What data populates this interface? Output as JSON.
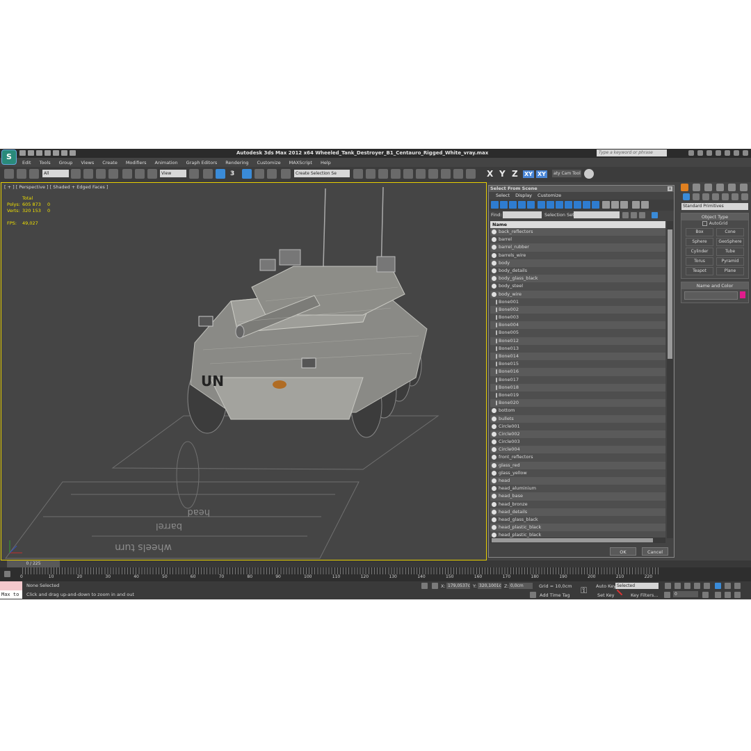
{
  "app": {
    "logo_letter": "S",
    "title": "Autodesk 3ds Max  2012 x64      Wheeled_Tank_Destroyer_B1_Centauro_Rigged_White_vray.max",
    "search_placeholder": "Type a keyword or phrase"
  },
  "menu": [
    "Edit",
    "Tools",
    "Group",
    "Views",
    "Create",
    "Modifiers",
    "Animation",
    "Graph Editors",
    "Rendering",
    "Customize",
    "MAXScript",
    "Help"
  ],
  "toolbar": {
    "filter": "All",
    "ref_coord": "View",
    "snap_label": "3",
    "selection_set": "Create Selection Se",
    "axes": [
      "X",
      "Y",
      "Z",
      "XY",
      "XY"
    ],
    "cam_tool": "aty Cam Tool"
  },
  "viewport": {
    "label": "[ + ] [ Perspective ] [ Shaded + Edged Faces ]",
    "stats": {
      "total_label": "Total",
      "polys_label": "Polys:",
      "polys_total": "605 873",
      "polys_sel": "0",
      "verts_label": "Verts:",
      "verts_total": "320 153",
      "verts_sel": "0",
      "fps_label": "FPS:",
      "fps_value": "49,027"
    },
    "hull_text": "UN",
    "ground_labels": [
      "head",
      "barrel",
      "wheels turn"
    ]
  },
  "dialog": {
    "title": "Select From Scene",
    "close_glyph": "x",
    "menu": [
      "Select",
      "Display",
      "Customize"
    ],
    "find_label": "Find:",
    "selection_set_label": "Selection Set:",
    "column_header": "Name",
    "items": [
      "back_reflectors",
      "barrel",
      "barrel_rubber",
      "barrels_wire",
      "body",
      "body_details",
      "body_glass_black",
      "body_steel",
      "body_wire",
      "Bone001",
      "Bone002",
      "Bone003",
      "Bone004",
      "Bone005",
      "Bone012",
      "Bone013",
      "Bone014",
      "Bone015",
      "Bone016",
      "Bone017",
      "Bone018",
      "Bone019",
      "Bone020",
      "bottom",
      "bullets",
      "Circle001",
      "Circle002",
      "Circle003",
      "Circle004",
      "front_reflectors",
      "glass_red",
      "glass_yellow",
      "head",
      "head_aluminium",
      "head_base",
      "head_bronze",
      "head_details",
      "head_glass_black",
      "head_plastic_black",
      "head_plastic_black"
    ],
    "ok_label": "OK",
    "cancel_label": "Cancel"
  },
  "command_panel": {
    "category": "Standard Primitives",
    "object_type_title": "Object Type",
    "autogrid_label": "AutoGrid",
    "buttons": [
      "Box",
      "Cone",
      "Sphere",
      "GeoSphere",
      "Cylinder",
      "Tube",
      "Torus",
      "Pyramid",
      "Teapot",
      "Plane"
    ],
    "name_color_title": "Name and Color",
    "color": "#e01c8c"
  },
  "timeline": {
    "slider_label": "0 / 225",
    "ticks": [
      "0",
      "10",
      "20",
      "30",
      "40",
      "50",
      "60",
      "70",
      "80",
      "90",
      "100",
      "110",
      "120",
      "130",
      "140",
      "150",
      "160",
      "170",
      "180",
      "190",
      "200",
      "210",
      "220"
    ]
  },
  "status": {
    "maxscript_label": "Max to",
    "selection": "None Selected",
    "prompt": "Click and drag up-and-down to zoom in and out",
    "x_label": "X:",
    "x_value": "179,0537c",
    "y_label": "Y:",
    "y_value": "320,1001c",
    "z_label": "Z:",
    "z_value": "0,0cm",
    "grid": "Grid = 10,0cm",
    "add_time_tag": "Add Time Tag",
    "auto_key": "Auto Key",
    "set_key": "Set Key",
    "key_mode": "Selected",
    "key_filters": "Key Filters...",
    "frame": "0"
  }
}
